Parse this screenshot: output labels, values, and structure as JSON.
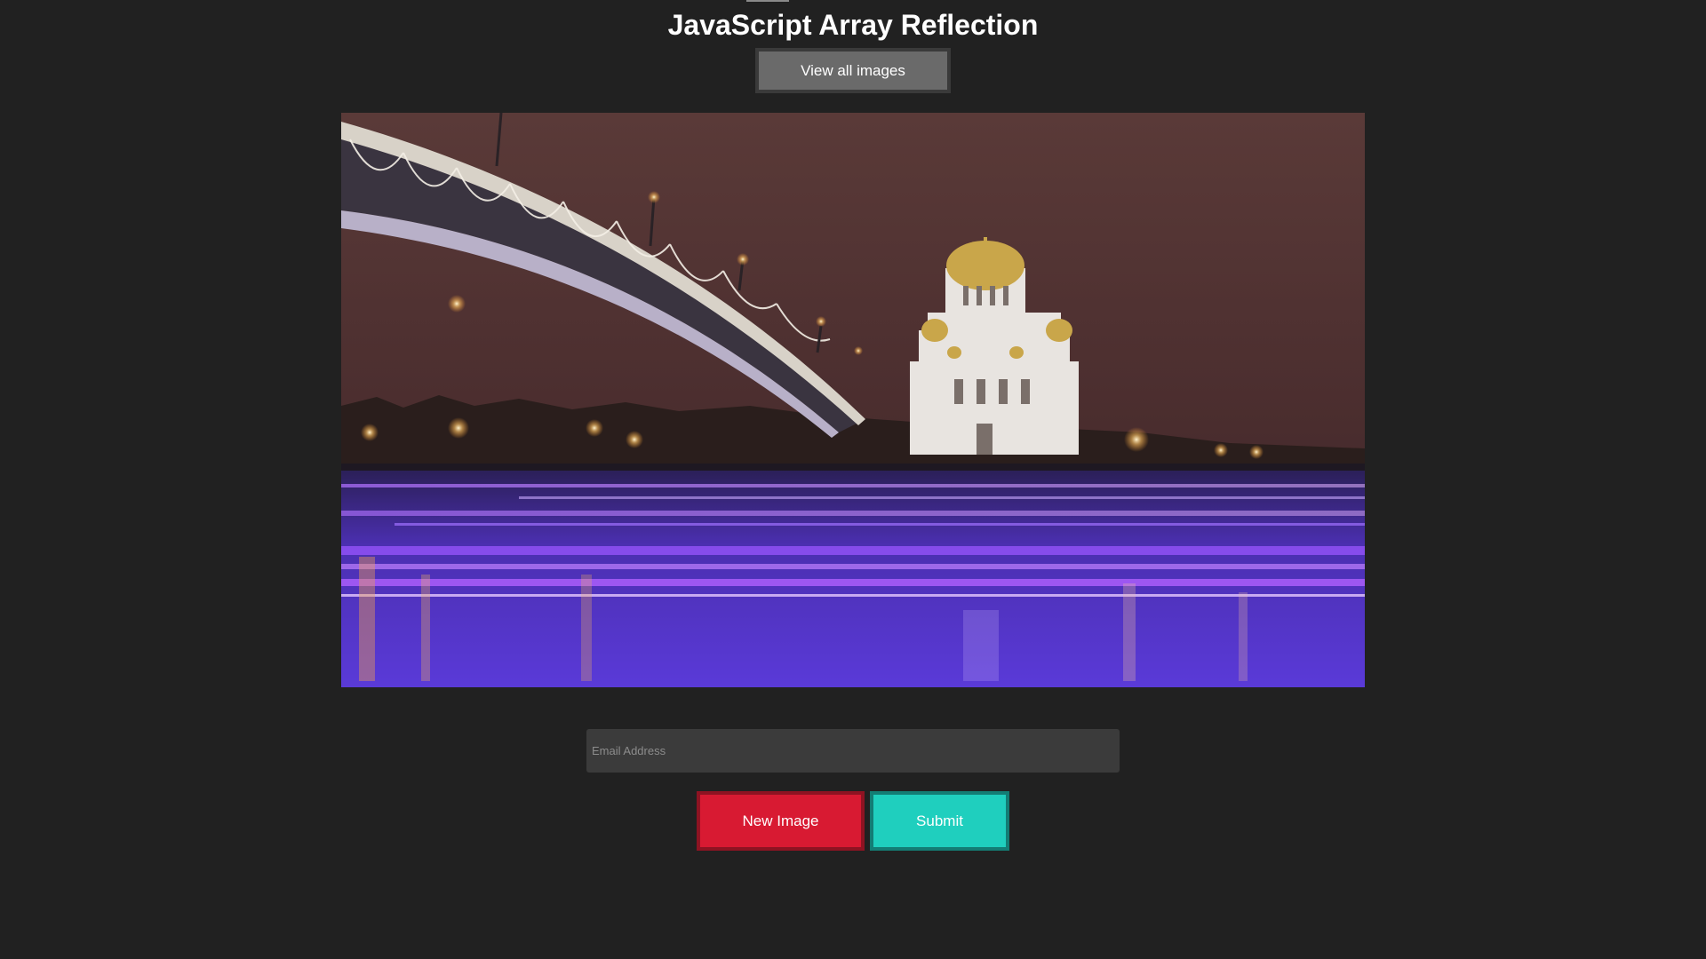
{
  "header": {
    "title": "JavaScript Array Reflection",
    "view_all_label": "View all images"
  },
  "image": {
    "subject": "night-river-bridge-cathedral-photo"
  },
  "form": {
    "email_placeholder": "Email Address",
    "email_value": "",
    "new_image_label": "New Image",
    "submit_label": "Submit"
  },
  "colors": {
    "background": "#212121",
    "view_all_button": "#6a6a6a",
    "new_image_button": "#d81a32",
    "submit_button": "#1fcfbe",
    "email_field": "#3b3b3b"
  }
}
